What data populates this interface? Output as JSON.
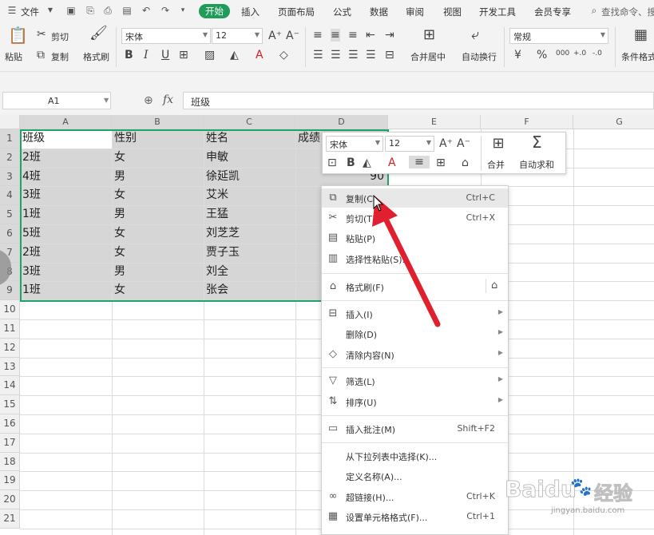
{
  "menubar": {
    "file": "文件",
    "tabs": [
      "开始",
      "插入",
      "页面布局",
      "公式",
      "数据",
      "审阅",
      "视图",
      "开发工具",
      "会员专享"
    ],
    "search": "查找命令、搜"
  },
  "ribbon": {
    "paste": "粘贴",
    "cut": "剪切",
    "copy": "复制",
    "format_painter": "格式刷",
    "font_name": "宋体",
    "font_size": "12",
    "merge_center": "合并居中",
    "wrap_text": "自动换行",
    "number_format": "常规",
    "conditional_format": "条件格式"
  },
  "formula_bar": {
    "name_box": "A1",
    "fx": "fx",
    "content": "班级"
  },
  "columns": [
    "A",
    "B",
    "C",
    "D",
    "E",
    "F",
    "G"
  ],
  "rows": [
    "1",
    "2",
    "3",
    "4",
    "5",
    "6",
    "7",
    "8",
    "9",
    "10",
    "11",
    "12",
    "13",
    "14",
    "15",
    "16",
    "17",
    "18",
    "19",
    "20",
    "21"
  ],
  "table": [
    [
      "班级",
      "性别",
      "姓名",
      "成绩"
    ],
    [
      "2班",
      "女",
      "申敏",
      ""
    ],
    [
      "4班",
      "男",
      "徐延凯",
      "90"
    ],
    [
      "3班",
      "女",
      "艾米",
      ""
    ],
    [
      "1班",
      "男",
      "王猛",
      ""
    ],
    [
      "5班",
      "女",
      "刘芝芝",
      ""
    ],
    [
      "2班",
      "女",
      "贾子玉",
      ""
    ],
    [
      "3班",
      "男",
      "刘全",
      ""
    ],
    [
      "1班",
      "女",
      "张会",
      ""
    ]
  ],
  "mini_toolbar": {
    "font_name": "宋体",
    "font_size": "12",
    "merge": "合并",
    "autosum": "自动求和"
  },
  "context_menu": {
    "copy": "复制(C)",
    "copy_shortcut": "Ctrl+C",
    "cut": "剪切(T)",
    "cut_shortcut": "Ctrl+X",
    "paste": "粘贴(P)",
    "paste_special": "选择性粘贴(S)...",
    "format_painter": "格式刷(F)",
    "insert": "插入(I)",
    "delete": "删除(D)",
    "clear": "清除内容(N)",
    "filter": "筛选(L)",
    "sort": "排序(U)",
    "insert_comment": "插入批注(M)",
    "insert_comment_shortcut": "Shift+F2",
    "pick_list": "从下拉列表中选择(K)...",
    "define_name": "定义名称(A)...",
    "hyperlink": "超链接(H)...",
    "hyperlink_shortcut": "Ctrl+K",
    "format_cells": "设置单元格格式(F)...",
    "format_cells_shortcut": "Ctrl+1"
  },
  "watermark": {
    "brand": "Baidu",
    "cn": "经验",
    "url": "jingyan.baidu.com"
  },
  "colors": {
    "accent_green": "#1f9c5a",
    "selection_border": "#21a366",
    "arrow_red": "#e0202e"
  }
}
